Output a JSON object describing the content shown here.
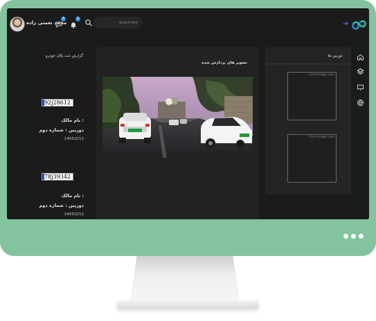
{
  "header": {
    "user_name": "محمد نعمتی زاده",
    "chat_badge": "3",
    "bell_badge": "3",
    "search_placeholder": "Search here"
  },
  "plate_report": {
    "title": "گزارش ثبت پلاک خودرو",
    "items": [
      {
        "plate": "92j28612",
        "owner_label": "نام مالک :",
        "camera": "دوربین : شماره دوم",
        "date": "1403/2/12"
      },
      {
        "plate": "78j39342",
        "owner_label": "نام مالک :",
        "camera": "دوربین : شماره دوم",
        "date": "1403/2/12"
      }
    ]
  },
  "processed_images": {
    "title": "تصویر های پردازش شده"
  },
  "cameras": {
    "title": "دوربین ها",
    "items": [
      {
        "alt": "Cord Image cam"
      },
      {
        "alt": "Cord Image cam"
      }
    ]
  },
  "colors": {
    "monitor": "#83c49f",
    "screen_bg": "#1b1b1b",
    "panel_bg": "#222222",
    "accent_teal": "#27c7a7",
    "accent_blue": "#2e8fe0",
    "arrow_purple": "#8b5cf6"
  },
  "icons": {
    "topbar": [
      "user-avatar",
      "chat-icon",
      "bell-icon",
      "search-icon",
      "arrow-right-icon",
      "logo-icon"
    ],
    "sidebar": [
      "home-icon",
      "layers-icon",
      "monitor-icon",
      "globe-icon"
    ]
  }
}
